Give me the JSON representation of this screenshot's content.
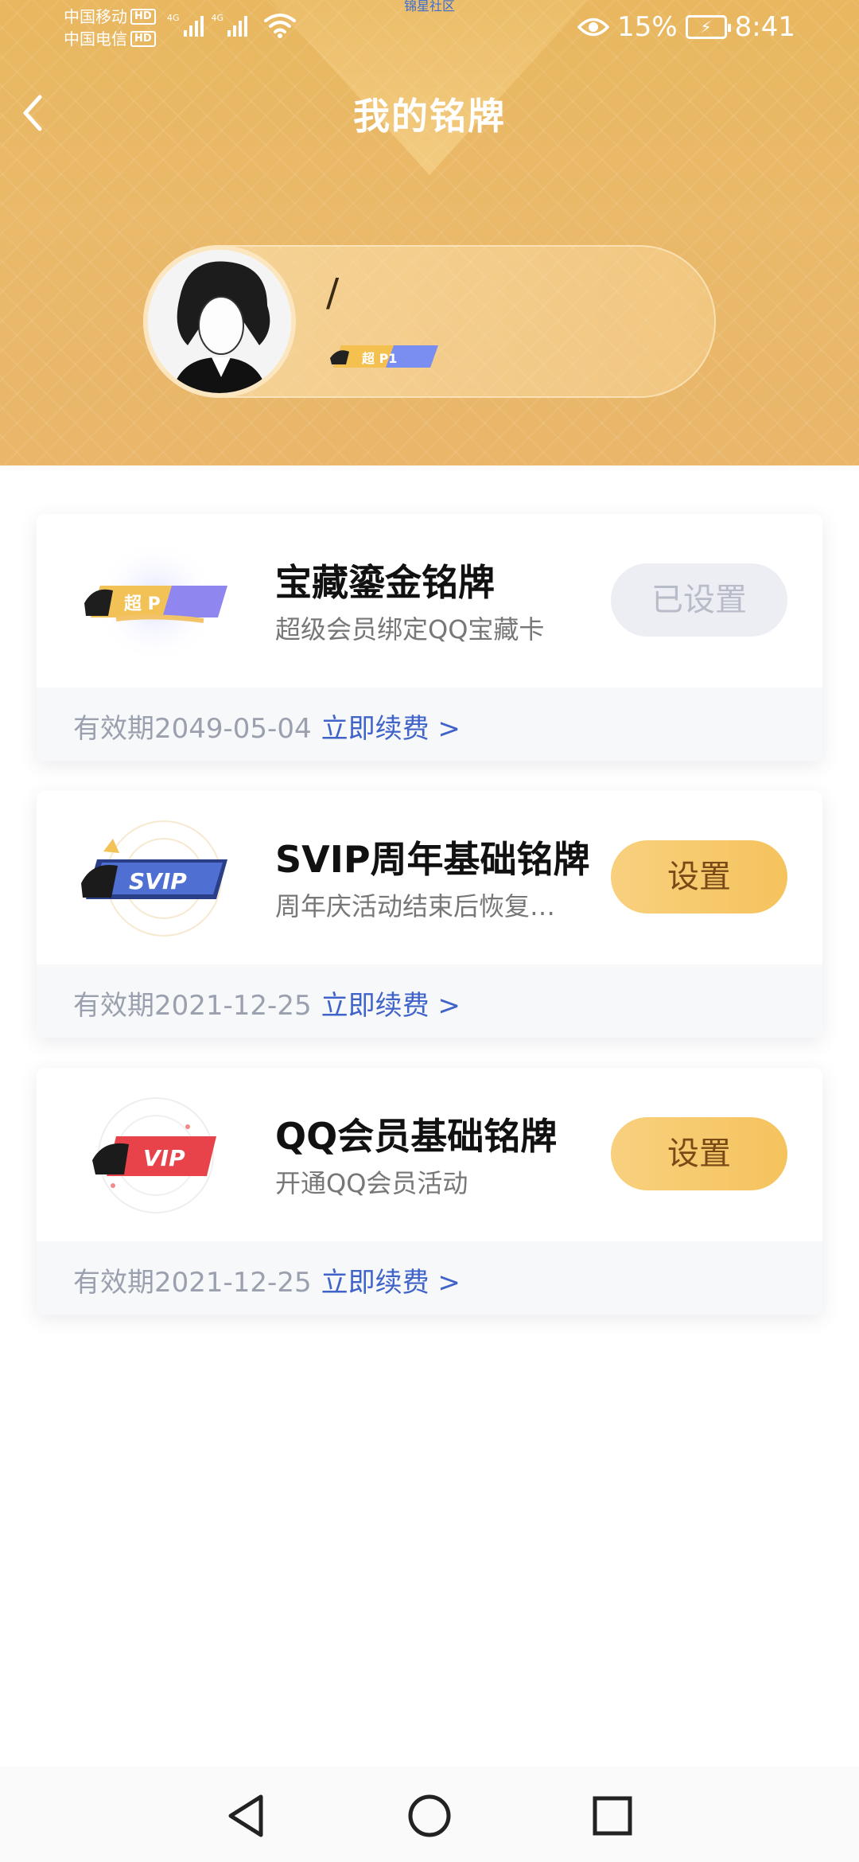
{
  "status_bar": {
    "carrier1": "中国移动",
    "carrier2": "中国电信",
    "hd_label": "HD",
    "network1": "4G",
    "network2": "4G",
    "mini_text": "锦星社区",
    "battery_percent": "15%",
    "time": "8:41",
    "icons": [
      "eye-icon",
      "battery-charging-icon",
      "wifi-icon",
      "signal-icon"
    ]
  },
  "header": {
    "title": "我的铭牌",
    "profile_name": "/",
    "profile_badge_text": "超 P1"
  },
  "cards": [
    {
      "badge_text": "超 P",
      "title": "宝藏鎏金铭牌",
      "subtitle": "超级会员绑定QQ宝藏卡",
      "button": "已设置",
      "button_state": "disabled",
      "validity": "有效期2049-05-04",
      "renew": "立即续费 >"
    },
    {
      "badge_text": "SVIP",
      "title": "SVIP周年基础铭牌",
      "subtitle": "周年庆活动结束后恢复…",
      "button": "设置",
      "button_state": "active",
      "validity": "有效期2021-12-25",
      "renew": "立即续费 >"
    },
    {
      "badge_text": "VIP",
      "title": "QQ会员基础铭牌",
      "subtitle": "开通QQ会员活动",
      "button": "设置",
      "button_state": "active",
      "validity": "有效期2021-12-25",
      "renew": "立即续费 >"
    }
  ],
  "colors": {
    "header_gold": "#e9b766",
    "button_gold": "#f6c766",
    "renew_blue": "#3f63c8",
    "disabled_bg": "#eceef3"
  }
}
